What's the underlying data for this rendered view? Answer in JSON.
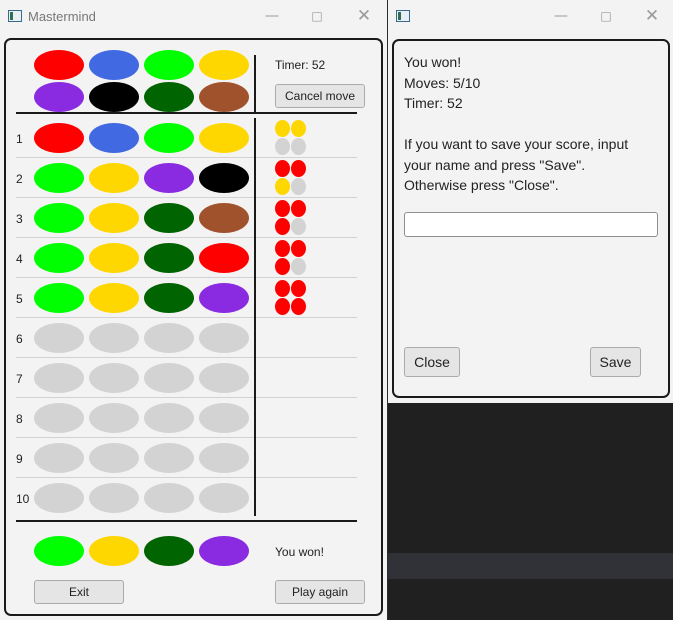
{
  "main_window": {
    "title": "Mastermind",
    "timer_text": "Timer: 52",
    "cancel_button": "Cancel move",
    "status_text": "You won!",
    "exit_button": "Exit",
    "play_again_button": "Play again"
  },
  "palette": [
    [
      "red",
      "blue",
      "green",
      "yellow"
    ],
    [
      "purple",
      "black",
      "dark-green",
      "brown"
    ]
  ],
  "colors": {
    "red": "#ff0000",
    "blue": "#4169e1",
    "green": "#00ff00",
    "yellow": "#ffd700",
    "purple": "#8a2be2",
    "black": "#000000",
    "dark-green": "#006400",
    "brown": "#a0522d",
    "empty": "#d3d3d3"
  },
  "rows": [
    {
      "number": "1",
      "pegs": [
        "red",
        "blue",
        "green",
        "yellow"
      ],
      "feedback": [
        "yellow",
        "yellow",
        "empty",
        "empty"
      ]
    },
    {
      "number": "2",
      "pegs": [
        "green",
        "yellow",
        "purple",
        "black"
      ],
      "feedback": [
        "red",
        "red",
        "yellow",
        "empty"
      ]
    },
    {
      "number": "3",
      "pegs": [
        "green",
        "yellow",
        "dark-green",
        "brown"
      ],
      "feedback": [
        "red",
        "red",
        "red",
        "empty"
      ]
    },
    {
      "number": "4",
      "pegs": [
        "green",
        "yellow",
        "dark-green",
        "red"
      ],
      "feedback": [
        "red",
        "red",
        "red",
        "empty"
      ]
    },
    {
      "number": "5",
      "pegs": [
        "green",
        "yellow",
        "dark-green",
        "purple"
      ],
      "feedback": [
        "red",
        "red",
        "red",
        "red"
      ]
    },
    {
      "number": "6",
      "pegs": [
        "empty",
        "empty",
        "empty",
        "empty"
      ],
      "feedback": []
    },
    {
      "number": "7",
      "pegs": [
        "empty",
        "empty",
        "empty",
        "empty"
      ],
      "feedback": []
    },
    {
      "number": "8",
      "pegs": [
        "empty",
        "empty",
        "empty",
        "empty"
      ],
      "feedback": []
    },
    {
      "number": "9",
      "pegs": [
        "empty",
        "empty",
        "empty",
        "empty"
      ],
      "feedback": []
    },
    {
      "number": "10",
      "pegs": [
        "empty",
        "empty",
        "empty",
        "empty"
      ],
      "feedback": []
    }
  ],
  "secret_code": [
    "green",
    "yellow",
    "dark-green",
    "purple"
  ],
  "dialog": {
    "message_lines": [
      "You won!",
      "Moves: 5/10",
      "Timer: 52",
      "",
      "If you want to save your score, input",
      "your name and press \"Save\".",
      "Otherwise press \"Close\"."
    ],
    "name_input_value": "",
    "close_button": "Close",
    "save_button": "Save"
  }
}
